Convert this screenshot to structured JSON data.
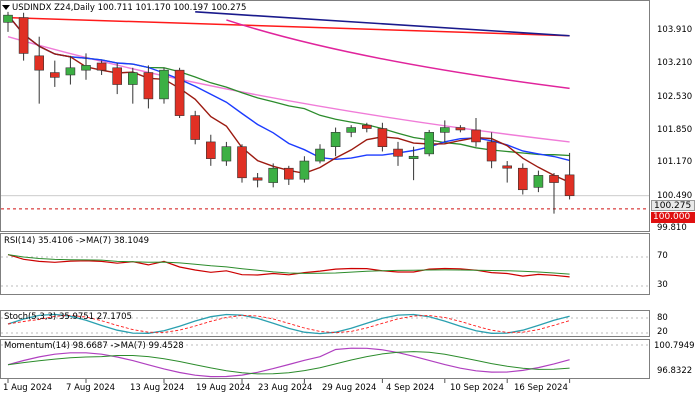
{
  "symbol_header": {
    "text": "USDINDX Z24,Daily  100.711 101.170 100.197 100.275"
  },
  "price_axis": {
    "ticks": [
      "103.910",
      "103.210",
      "102.530",
      "101.850",
      "101.170",
      "100.490",
      "99.810"
    ],
    "current_price_tag": "100.275",
    "level_tag": "100.000"
  },
  "rsi_panel": {
    "header": "RSI(14) 35.4106  ->MA(7) 38.1049",
    "ticks": [
      "70",
      "30"
    ]
  },
  "stoch_panel": {
    "header": "Stoch(5,3,3) 35.9751 27.1705",
    "ticks": [
      "80",
      "20"
    ]
  },
  "momentum_panel": {
    "header": "Momentum(14) 98.6687  ->MA(7) 99.4528",
    "ticks": [
      "100.7949",
      "96.8322"
    ]
  },
  "time_axis": {
    "labels": [
      "1 Aug 2024",
      "7 Aug 2024",
      "13 Aug 2024",
      "19 Aug 2024",
      "23 Aug 2024",
      "29 Aug 2024",
      "4 Sep 2024",
      "10 Sep 2024",
      "16 Sep 2024"
    ]
  },
  "colors": {
    "bull": "#3cb044",
    "bear": "#e03024",
    "ma_red": "#ff1a1a",
    "ma_navy": "#1a1a8c",
    "ma_magenta": "#e0249c",
    "ma_pink": "#f07cd8",
    "ma_green": "#2c8c2c",
    "ma_blue": "#1c3cff",
    "ma_darkred": "#9c1a10",
    "level_line": "#d01010",
    "rsi_line": "#cc0000",
    "stoch_main": "#2aa0b0",
    "momentum_line": "#b040c0"
  },
  "chart_data": {
    "type": "candlestick",
    "title": "USDINDX Z24,Daily",
    "x": [
      "1 Aug",
      "2 Aug",
      "5 Aug",
      "6 Aug",
      "7 Aug",
      "8 Aug",
      "9 Aug",
      "12 Aug",
      "13 Aug",
      "14 Aug",
      "15 Aug",
      "16 Aug",
      "19 Aug",
      "20 Aug",
      "21 Aug",
      "22 Aug",
      "23 Aug",
      "26 Aug",
      "27 Aug",
      "28 Aug",
      "29 Aug",
      "30 Aug",
      "2 Sep",
      "3 Sep",
      "4 Sep",
      "5 Sep",
      "6 Sep",
      "9 Sep",
      "10 Sep",
      "11 Sep",
      "12 Sep",
      "13 Sep",
      "16 Sep",
      "17 Sep",
      "18 Sep",
      "19 Sep",
      "20 Sep"
    ],
    "ohlc": [
      [
        103.9,
        104.12,
        103.7,
        104.05
      ],
      [
        104.0,
        104.1,
        103.1,
        103.25
      ],
      [
        103.2,
        103.6,
        102.2,
        102.9
      ],
      [
        102.85,
        103.1,
        102.55,
        102.75
      ],
      [
        102.8,
        103.2,
        102.6,
        102.95
      ],
      [
        102.9,
        103.25,
        102.7,
        103.0
      ],
      [
        103.05,
        103.1,
        102.8,
        102.9
      ],
      [
        102.95,
        103.05,
        102.4,
        102.6
      ],
      [
        102.6,
        102.95,
        102.2,
        102.85
      ],
      [
        102.85,
        103.0,
        102.1,
        102.3
      ],
      [
        102.3,
        102.95,
        102.2,
        102.9
      ],
      [
        102.9,
        102.95,
        101.9,
        101.95
      ],
      [
        101.95,
        102.05,
        101.35,
        101.45
      ],
      [
        101.4,
        101.55,
        100.9,
        101.05
      ],
      [
        101.0,
        101.4,
        100.9,
        101.3
      ],
      [
        101.3,
        101.35,
        100.55,
        100.65
      ],
      [
        100.65,
        100.75,
        100.45,
        100.6
      ],
      [
        100.55,
        100.95,
        100.45,
        100.85
      ],
      [
        100.85,
        100.9,
        100.5,
        100.62
      ],
      [
        100.62,
        101.1,
        100.55,
        101.0
      ],
      [
        101.0,
        101.35,
        100.95,
        101.25
      ],
      [
        101.3,
        101.7,
        101.1,
        101.6
      ],
      [
        101.6,
        101.75,
        101.5,
        101.7
      ],
      [
        101.75,
        101.8,
        101.6,
        101.68
      ],
      [
        101.68,
        101.8,
        101.2,
        101.3
      ],
      [
        101.25,
        101.4,
        100.9,
        101.1
      ],
      [
        101.05,
        101.3,
        100.6,
        101.1
      ],
      [
        101.15,
        101.65,
        101.1,
        101.6
      ],
      [
        101.6,
        101.85,
        101.4,
        101.7
      ],
      [
        101.7,
        101.75,
        101.6,
        101.65
      ],
      [
        101.65,
        101.9,
        101.3,
        101.4
      ],
      [
        101.4,
        101.6,
        100.85,
        101.0
      ],
      [
        100.9,
        101.0,
        100.55,
        100.85
      ],
      [
        100.85,
        100.95,
        100.3,
        100.4
      ],
      [
        100.45,
        100.8,
        100.35,
        100.7
      ],
      [
        100.7,
        100.75,
        99.9,
        100.55
      ],
      [
        100.711,
        101.17,
        100.197,
        100.275
      ]
    ],
    "horizontal_levels": [
      100.0
    ],
    "ylim": [
      99.6,
      104.2
    ],
    "rsi": {
      "value": 35.4106,
      "ma": 38.1049,
      "levels": [
        70,
        30
      ]
    },
    "stochastic": {
      "k": 35.9751,
      "d": 27.1705,
      "levels": [
        80,
        20
      ]
    },
    "momentum": {
      "value": 98.6687,
      "ma": 99.4528
    }
  }
}
